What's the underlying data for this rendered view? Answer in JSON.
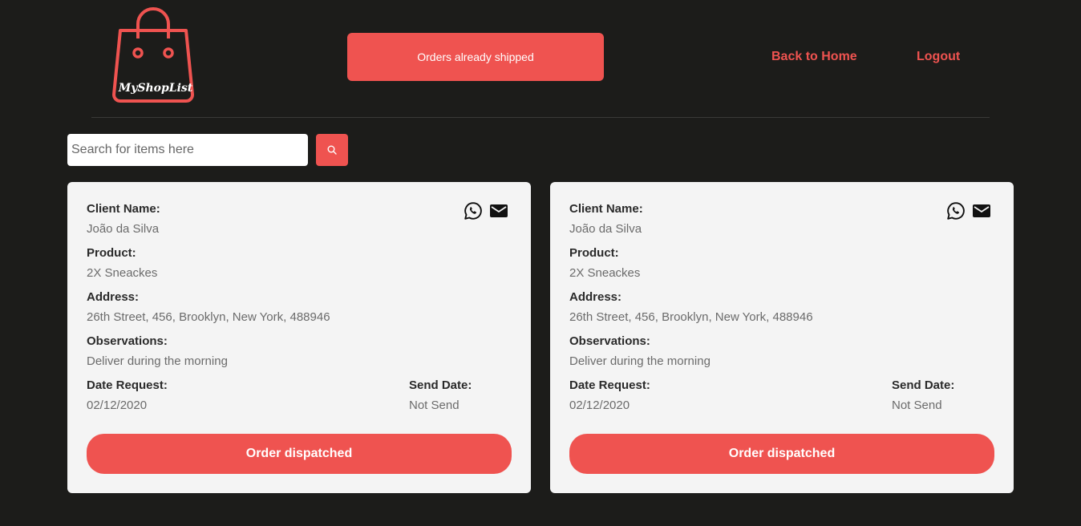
{
  "header": {
    "logo_text": "MyShopList",
    "shipped_button_label": "Orders already shipped",
    "nav_home_label": "Back to Home",
    "nav_logout_label": "Logout"
  },
  "search": {
    "placeholder": "Search for items here",
    "button_icon": "search-icon"
  },
  "colors": {
    "accent": "#ef5350",
    "background": "#1c1c1a",
    "card": "#f4f4f4"
  },
  "orders": [
    {
      "client_name_label": "Client Name:",
      "client_name": "João da Silva",
      "product_label": "Product:",
      "product": "2X Sneackes",
      "address_label": "Address:",
      "address": "26th Street, 456, Brooklyn, New York, 488946",
      "observations_label": "Observations:",
      "observations": "Deliver during the morning",
      "date_request_label": "Date Request:",
      "date_request": "02/12/2020",
      "send_date_label": "Send Date:",
      "send_date": "Not Send",
      "action_label": "Order dispatched",
      "icons": [
        "whatsapp-icon",
        "mail-icon"
      ]
    },
    {
      "client_name_label": "Client Name:",
      "client_name": "João da Silva",
      "product_label": "Product:",
      "product": "2X Sneackes",
      "address_label": "Address:",
      "address": "26th Street, 456, Brooklyn, New York, 488946",
      "observations_label": "Observations:",
      "observations": "Deliver during the morning",
      "date_request_label": "Date Request:",
      "date_request": "02/12/2020",
      "send_date_label": "Send Date:",
      "send_date": "Not Send",
      "action_label": "Order dispatched",
      "icons": [
        "whatsapp-icon",
        "mail-icon"
      ]
    }
  ]
}
